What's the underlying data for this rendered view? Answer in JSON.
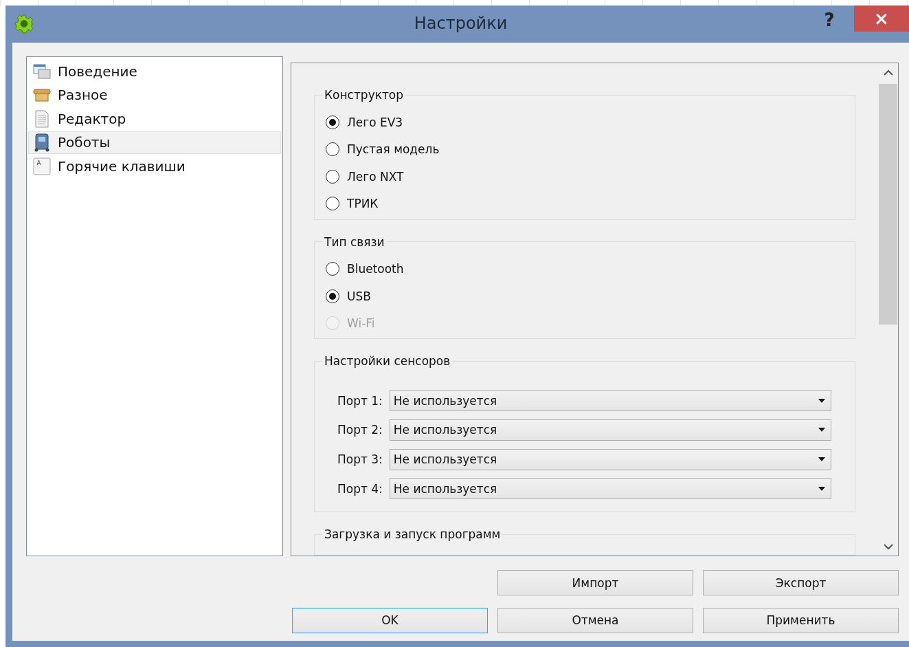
{
  "window": {
    "title": "Настройки",
    "help": "?",
    "close": "×"
  },
  "sidebar": {
    "items": [
      {
        "label": "Поведение",
        "kind": "windows",
        "selected": false
      },
      {
        "label": "Разное",
        "kind": "box",
        "selected": false
      },
      {
        "label": "Редактор",
        "kind": "document",
        "selected": false
      },
      {
        "label": "Роботы",
        "kind": "robot",
        "selected": true
      },
      {
        "label": "Горячие клавиши",
        "kind": "key",
        "selected": false
      }
    ]
  },
  "groups": [
    {
      "title": "Конструктор",
      "kind": "radios",
      "options": [
        {
          "label": "Лего EV3",
          "selected": true,
          "disabled": false
        },
        {
          "label": "Пустая модель",
          "selected": false,
          "disabled": false
        },
        {
          "label": "Лего NXT",
          "selected": false,
          "disabled": false
        },
        {
          "label": "ТРИК",
          "selected": false,
          "disabled": false
        }
      ]
    },
    {
      "title": "Тип связи",
      "kind": "radios",
      "options": [
        {
          "label": "Bluetooth",
          "selected": false,
          "disabled": false
        },
        {
          "label": "USB",
          "selected": true,
          "disabled": false
        },
        {
          "label": "Wi-Fi",
          "selected": false,
          "disabled": true
        }
      ]
    },
    {
      "title": "Настройки сенсоров",
      "kind": "ports",
      "ports": [
        {
          "label": "Порт 1:",
          "value": "Не используется"
        },
        {
          "label": "Порт 2:",
          "value": "Не используется"
        },
        {
          "label": "Порт 3:",
          "value": "Не используется"
        },
        {
          "label": "Порт 4:",
          "value": "Не используется"
        }
      ]
    },
    {
      "title": "Загрузка и запуск программ",
      "kind": "cut"
    }
  ],
  "buttons": [
    {
      "label": "Импорт",
      "focused": false
    },
    {
      "label": "Экспорт",
      "focused": false
    },
    {
      "label": "OK",
      "focused": true
    },
    {
      "label": "Отмена",
      "focused": false
    },
    {
      "label": "Применить",
      "focused": false
    }
  ]
}
